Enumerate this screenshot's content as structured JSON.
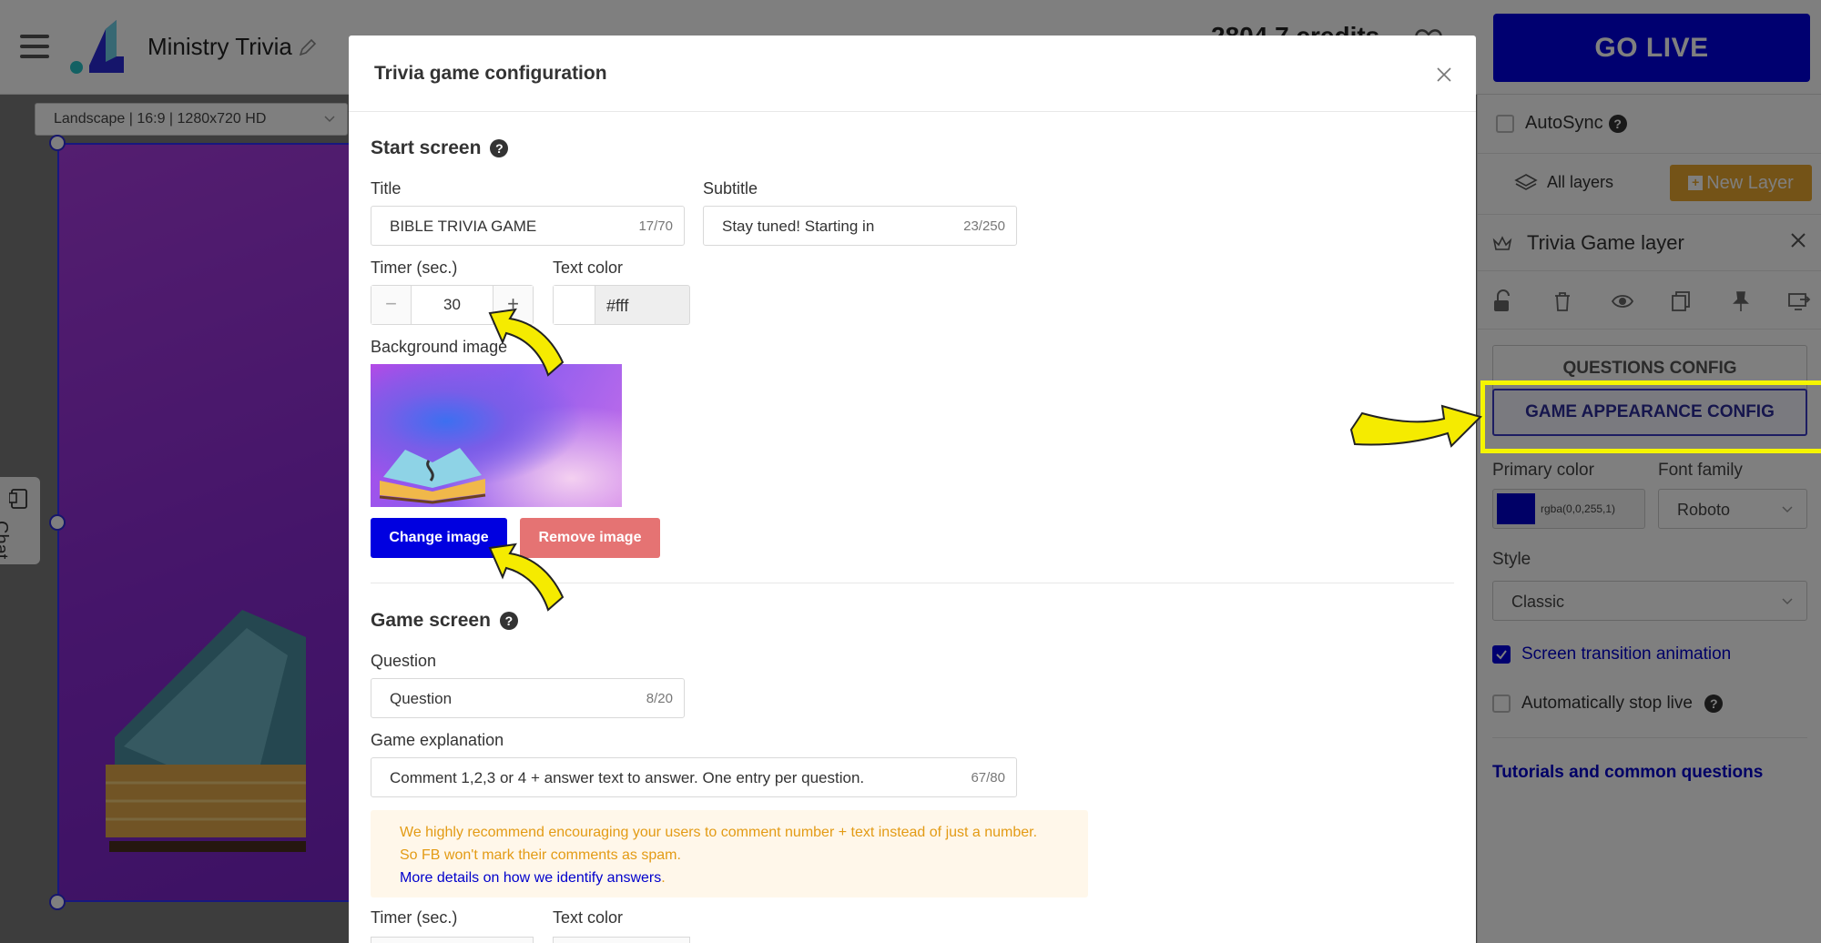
{
  "app": {
    "title": "Ministry Trivia",
    "credits": "2804.7 credits",
    "go_live": "GO LIVE",
    "canvas_option": "Landscape | 16:9 | 1280x720 HD",
    "chat_label": "Chat"
  },
  "right_panel": {
    "autosync": "AutoSync",
    "all_layers": "All layers",
    "new_layer": "New Layer",
    "layer_title": "Trivia Game layer",
    "questions_config": "QUESTIONS CONFIG",
    "appearance_config": "GAME APPEARANCE CONFIG",
    "primary_color_label": "Primary color",
    "primary_color_value": "rgba(0,0,255,1)",
    "font_family_label": "Font family",
    "font_family_value": "Roboto",
    "style_label": "Style",
    "style_value": "Classic",
    "transition_label": "Screen transition animation",
    "transition_checked": true,
    "auto_stop_label": "Automatically stop live",
    "auto_stop_checked": false,
    "tutorials": "Tutorials and common questions",
    "accent_color": "#0000e0"
  },
  "modal": {
    "title": "Trivia game configuration",
    "start": {
      "heading": "Start screen",
      "title_label": "Title",
      "title_value": "BIBLE TRIVIA GAME",
      "title_count": "17/70",
      "subtitle_label": "Subtitle",
      "subtitle_value": "Stay tuned! Starting in",
      "subtitle_count": "23/250",
      "timer_label": "Timer (sec.)",
      "timer_value": "30",
      "minus": "−",
      "plus": "+",
      "text_color_label": "Text color",
      "text_color_value": "#fff",
      "bg_label": "Background image",
      "change_image": "Change image",
      "remove_image": "Remove image"
    },
    "game": {
      "heading": "Game screen",
      "question_label": "Question",
      "question_value": "Question",
      "question_count": "8/20",
      "explanation_label": "Game explanation",
      "explanation_value": "Comment 1,2,3 or 4 + answer text to answer. One entry per question.",
      "explanation_count": "67/80",
      "warning_line1": "We highly recommend encouraging your users to comment number + text instead of just a number.",
      "warning_line2": "So FB won't mark their comments as spam.",
      "warning_link": "More details on how we identify answers",
      "warning_dot": ".",
      "timer_label": "Timer (sec.)",
      "text_color_label": "Text color"
    }
  },
  "icons": {
    "help": "?",
    "annotation_arrow_color": "#f5eb00"
  }
}
